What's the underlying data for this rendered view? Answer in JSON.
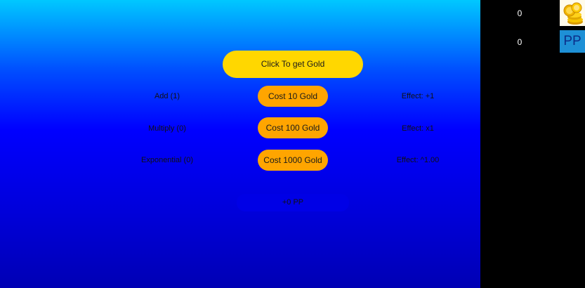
{
  "main": {
    "click_button_label": "Click To get Gold",
    "upgrades": [
      {
        "name": "Add (1)",
        "cost": "Cost 10 Gold",
        "effect": "Effect: +1"
      },
      {
        "name": "Multiply (0)",
        "cost": "Cost 100 Gold",
        "effect": "Effect: x1"
      },
      {
        "name": "Exponential (0)",
        "cost": "Cost 1000 Gold",
        "effect": "Effect: ^1.00"
      }
    ],
    "prestige_label": "+0 PP"
  },
  "sidebar": {
    "gold_count": "0",
    "pp_count": "0",
    "pp_icon_text": "PP"
  },
  "colors": {
    "click_button": "#ffd700",
    "cost_button": "#ffa500",
    "pp_icon": "#1e90d6"
  },
  "icons": {
    "gold": "gold-coins-icon",
    "pp": "pp-icon"
  }
}
